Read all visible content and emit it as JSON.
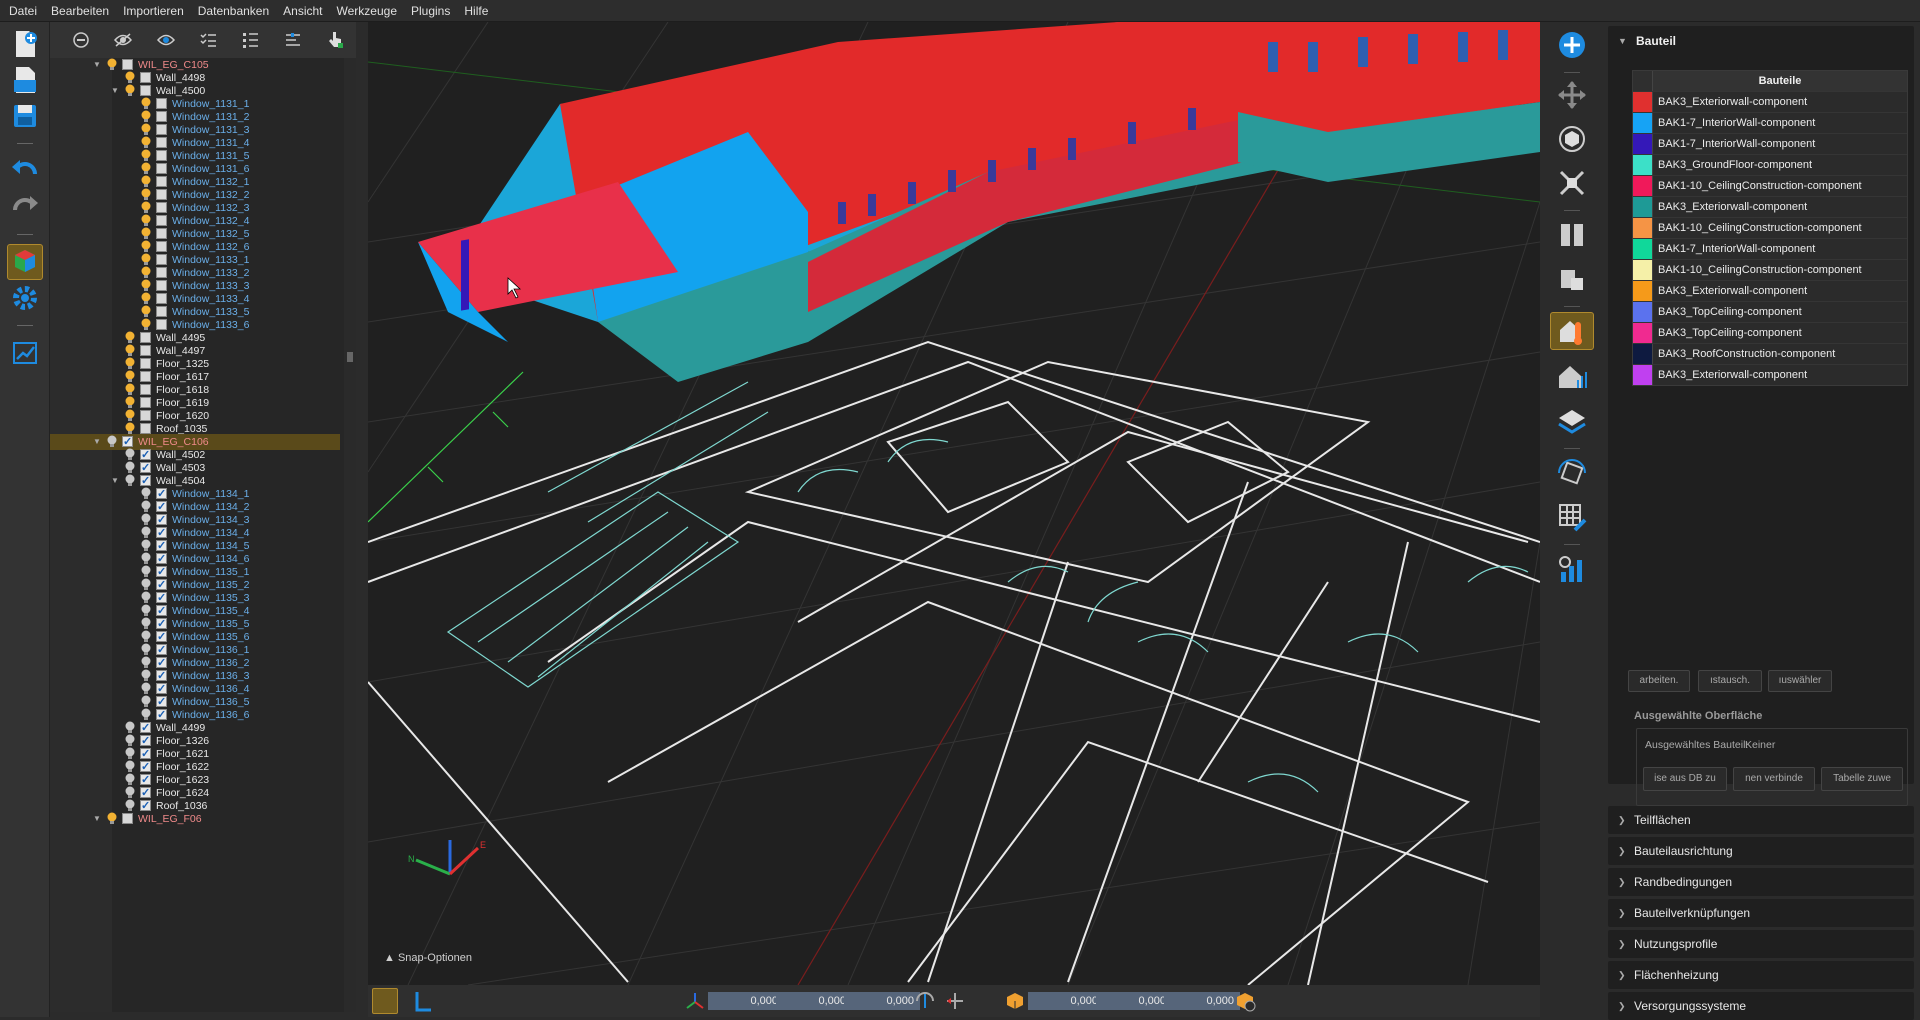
{
  "menubar": [
    "Datei",
    "Bearbeiten",
    "Importieren",
    "Datenbanken",
    "Ansicht",
    "Werkzeuge",
    "Plugins",
    "Hilfe"
  ],
  "tree": {
    "rows": [
      {
        "level": 0,
        "label": "WIL_EG_C105",
        "kind": "group",
        "expand": "open",
        "bulb": "on",
        "checked": false
      },
      {
        "level": 1,
        "label": "Wall_4498",
        "kind": "plain",
        "expand": "",
        "bulb": "on",
        "checked": false
      },
      {
        "level": 1,
        "label": "Wall_4500",
        "kind": "plain",
        "expand": "open",
        "bulb": "on",
        "checked": false
      },
      {
        "level": 2,
        "label": "Window_1131_1",
        "kind": "win",
        "bulb": "on",
        "checked": false
      },
      {
        "level": 2,
        "label": "Window_1131_2",
        "kind": "win",
        "bulb": "on",
        "checked": false
      },
      {
        "level": 2,
        "label": "Window_1131_3",
        "kind": "win",
        "bulb": "on",
        "checked": false
      },
      {
        "level": 2,
        "label": "Window_1131_4",
        "kind": "win",
        "bulb": "on",
        "checked": false
      },
      {
        "level": 2,
        "label": "Window_1131_5",
        "kind": "win",
        "bulb": "on",
        "checked": false
      },
      {
        "level": 2,
        "label": "Window_1131_6",
        "kind": "win",
        "bulb": "on",
        "checked": false
      },
      {
        "level": 2,
        "label": "Window_1132_1",
        "kind": "win",
        "bulb": "on",
        "checked": false
      },
      {
        "level": 2,
        "label": "Window_1132_2",
        "kind": "win",
        "bulb": "on",
        "checked": false
      },
      {
        "level": 2,
        "label": "Window_1132_3",
        "kind": "win",
        "bulb": "on",
        "checked": false
      },
      {
        "level": 2,
        "label": "Window_1132_4",
        "kind": "win",
        "bulb": "on",
        "checked": false
      },
      {
        "level": 2,
        "label": "Window_1132_5",
        "kind": "win",
        "bulb": "on",
        "checked": false
      },
      {
        "level": 2,
        "label": "Window_1132_6",
        "kind": "win",
        "bulb": "on",
        "checked": false
      },
      {
        "level": 2,
        "label": "Window_1133_1",
        "kind": "win",
        "bulb": "on",
        "checked": false
      },
      {
        "level": 2,
        "label": "Window_1133_2",
        "kind": "win",
        "bulb": "on",
        "checked": false
      },
      {
        "level": 2,
        "label": "Window_1133_3",
        "kind": "win",
        "bulb": "on",
        "checked": false
      },
      {
        "level": 2,
        "label": "Window_1133_4",
        "kind": "win",
        "bulb": "on",
        "checked": false
      },
      {
        "level": 2,
        "label": "Window_1133_5",
        "kind": "win",
        "bulb": "on",
        "checked": false
      },
      {
        "level": 2,
        "label": "Window_1133_6",
        "kind": "win",
        "bulb": "on",
        "checked": false
      },
      {
        "level": 1,
        "label": "Wall_4495",
        "kind": "plain",
        "bulb": "on",
        "checked": false
      },
      {
        "level": 1,
        "label": "Wall_4497",
        "kind": "plain",
        "bulb": "on",
        "checked": false
      },
      {
        "level": 1,
        "label": "Floor_1325",
        "kind": "plain",
        "bulb": "on",
        "checked": false
      },
      {
        "level": 1,
        "label": "Floor_1617",
        "kind": "plain",
        "bulb": "on",
        "checked": false
      },
      {
        "level": 1,
        "label": "Floor_1618",
        "kind": "plain",
        "bulb": "on",
        "checked": false
      },
      {
        "level": 1,
        "label": "Floor_1619",
        "kind": "plain",
        "bulb": "on",
        "checked": false
      },
      {
        "level": 1,
        "label": "Floor_1620",
        "kind": "plain",
        "bulb": "on",
        "checked": false
      },
      {
        "level": 1,
        "label": "Roof_1035",
        "kind": "plain",
        "bulb": "on",
        "checked": false
      },
      {
        "level": 0,
        "label": "WIL_EG_C106",
        "kind": "group",
        "expand": "open",
        "bulb": "off",
        "checked": true,
        "selected": true
      },
      {
        "level": 1,
        "label": "Wall_4502",
        "kind": "plain",
        "bulb": "off",
        "checked": true
      },
      {
        "level": 1,
        "label": "Wall_4503",
        "kind": "plain",
        "bulb": "off",
        "checked": true
      },
      {
        "level": 1,
        "label": "Wall_4504",
        "kind": "plain",
        "expand": "open",
        "bulb": "off",
        "checked": true
      },
      {
        "level": 2,
        "label": "Window_1134_1",
        "kind": "win",
        "bulb": "off",
        "checked": true
      },
      {
        "level": 2,
        "label": "Window_1134_2",
        "kind": "win",
        "bulb": "off",
        "checked": true
      },
      {
        "level": 2,
        "label": "Window_1134_3",
        "kind": "win",
        "bulb": "off",
        "checked": true
      },
      {
        "level": 2,
        "label": "Window_1134_4",
        "kind": "win",
        "bulb": "off",
        "checked": true
      },
      {
        "level": 2,
        "label": "Window_1134_5",
        "kind": "win",
        "bulb": "off",
        "checked": true
      },
      {
        "level": 2,
        "label": "Window_1134_6",
        "kind": "win",
        "bulb": "off",
        "checked": true
      },
      {
        "level": 2,
        "label": "Window_1135_1",
        "kind": "win",
        "bulb": "off",
        "checked": true
      },
      {
        "level": 2,
        "label": "Window_1135_2",
        "kind": "win",
        "bulb": "off",
        "checked": true
      },
      {
        "level": 2,
        "label": "Window_1135_3",
        "kind": "win",
        "bulb": "off",
        "checked": true
      },
      {
        "level": 2,
        "label": "Window_1135_4",
        "kind": "win",
        "bulb": "off",
        "checked": true
      },
      {
        "level": 2,
        "label": "Window_1135_5",
        "kind": "win",
        "bulb": "off",
        "checked": true
      },
      {
        "level": 2,
        "label": "Window_1135_6",
        "kind": "win",
        "bulb": "off",
        "checked": true
      },
      {
        "level": 2,
        "label": "Window_1136_1",
        "kind": "win",
        "bulb": "off",
        "checked": true
      },
      {
        "level": 2,
        "label": "Window_1136_2",
        "kind": "win",
        "bulb": "off",
        "checked": true
      },
      {
        "level": 2,
        "label": "Window_1136_3",
        "kind": "win",
        "bulb": "off",
        "checked": true
      },
      {
        "level": 2,
        "label": "Window_1136_4",
        "kind": "win",
        "bulb": "off",
        "checked": true
      },
      {
        "level": 2,
        "label": "Window_1136_5",
        "kind": "win",
        "bulb": "off",
        "checked": true
      },
      {
        "level": 2,
        "label": "Window_1136_6",
        "kind": "win",
        "bulb": "off",
        "checked": true
      },
      {
        "level": 1,
        "label": "Wall_4499",
        "kind": "plain",
        "bulb": "off",
        "checked": true
      },
      {
        "level": 1,
        "label": "Floor_1326",
        "kind": "plain",
        "bulb": "off",
        "checked": true
      },
      {
        "level": 1,
        "label": "Floor_1621",
        "kind": "plain",
        "bulb": "off",
        "checked": true
      },
      {
        "level": 1,
        "label": "Floor_1622",
        "kind": "plain",
        "bulb": "off",
        "checked": true
      },
      {
        "level": 1,
        "label": "Floor_1623",
        "kind": "plain",
        "bulb": "off",
        "checked": true
      },
      {
        "level": 1,
        "label": "Floor_1624",
        "kind": "plain",
        "bulb": "off",
        "checked": true
      },
      {
        "level": 1,
        "label": "Roof_1036",
        "kind": "plain",
        "bulb": "off",
        "checked": true
      },
      {
        "level": 0,
        "label": "WIL_EG_F06",
        "kind": "group",
        "expand": "open",
        "bulb": "on",
        "checked": false
      }
    ]
  },
  "viewport": {
    "snap_label": "Snap-Optionen",
    "coords": [
      "0,000",
      "0,000",
      "0,000",
      "0,000",
      "0,000",
      "0,000"
    ]
  },
  "panel": {
    "bauteil_title": "Bauteil",
    "table_header": "Bauteile",
    "components": [
      {
        "name": "BAK3_Exteriorwall-component",
        "color": "#e0302f"
      },
      {
        "name": "BAK1-7_InteriorWall-component",
        "color": "#16a3f5"
      },
      {
        "name": "BAK1-7_InteriorWall-component",
        "color": "#3418b8"
      },
      {
        "name": "BAK3_GroundFloor-component",
        "color": "#3ce0c8"
      },
      {
        "name": "BAK1-10_CeilingConstruction-component",
        "color": "#f0195a"
      },
      {
        "name": "BAK3_Exteriorwall-component",
        "color": "#1e9a96"
      },
      {
        "name": "BAK1-10_CeilingConstruction-component",
        "color": "#f59445"
      },
      {
        "name": "BAK1-7_InteriorWall-component",
        "color": "#10d89a"
      },
      {
        "name": "BAK1-10_CeilingConstruction-component",
        "color": "#f5f0a8"
      },
      {
        "name": "BAK3_Exteriorwall-component",
        "color": "#f59a1a"
      },
      {
        "name": "BAK3_TopCeiling-component",
        "color": "#5b72ee"
      },
      {
        "name": "BAK3_TopCeiling-component",
        "color": "#f02a90"
      },
      {
        "name": "BAK3_RoofConstruction-component",
        "color": "#0e1a40"
      },
      {
        "name": "BAK3_Exteriorwall-component",
        "color": "#c040f0"
      }
    ],
    "buttons": [
      "arbeiten.",
      "ıstausch.",
      "ıuswähler"
    ],
    "selected_surface_title": "Ausgewählte Oberfläche",
    "selected_component_label": "Ausgewähltes Bauteil:",
    "selected_component_value": "Keiner",
    "sel_buttons": [
      "ise aus DB zu",
      "nen verbinde",
      "Tabelle zuwe"
    ],
    "sections": [
      "Teilflächen",
      "Bauteilausrichtung",
      "Randbedingungen",
      "Bauteilverknüpfungen",
      "Nutzungsprofile",
      "Flächenheizung",
      "Versorgungssysteme"
    ]
  }
}
